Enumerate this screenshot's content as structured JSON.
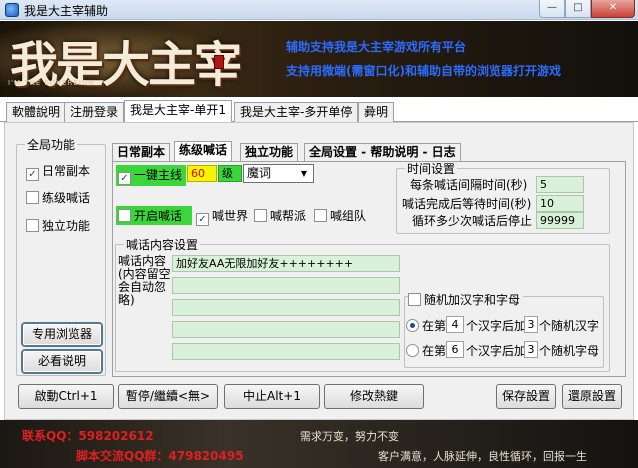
{
  "window": {
    "title": "我是大主宰辅助"
  },
  "banner": {
    "logo_text": "我是大主宰",
    "logo_sub": "I'M THE SOVEREIGN",
    "line1": "辅助支持我是大主宰游戏所有平台",
    "line2": "支持用微端(需窗口化)和辅助自带的浏览器打开游戏"
  },
  "main_tabs": [
    "軟體說明",
    "注册登录",
    "我是大主宰-单开1",
    "我是大主宰-多开单停",
    "彜明"
  ],
  "global": {
    "legend": "全局功能",
    "items": [
      {
        "label": "日常副本",
        "checked": true
      },
      {
        "label": "练级喊话",
        "checked": false
      },
      {
        "label": "独立功能",
        "checked": false
      }
    ],
    "browser_btn": "专用浏览器",
    "help_btn": "必看说明"
  },
  "sub_tabs": [
    "日常副本",
    "练级喊话",
    "独立功能",
    "全局设置 - 帮助说明 - 日志"
  ],
  "level": {
    "label": "一键主线",
    "value": "60",
    "unit": "级",
    "select": "魔词"
  },
  "channels": [
    {
      "label": "开启喊话",
      "checked": false,
      "green": true
    },
    {
      "label": "喊世界",
      "checked": true
    },
    {
      "label": "喊帮派",
      "checked": false
    },
    {
      "label": "喊组队",
      "checked": false
    }
  ],
  "timing": {
    "legend": "时间设置",
    "rows": [
      {
        "label": "每条喊话间隔时间(秒)",
        "value": "5"
      },
      {
        "label": "喊话完成后等待时间(秒)",
        "value": "10"
      },
      {
        "label": "循环多少次喊话后停止",
        "value": "99999"
      }
    ]
  },
  "content": {
    "legend": "喊话内容设置",
    "label": "喊话内容(内容留空会自动忽略)",
    "lines": [
      "加好友AA无限加好友++++++++",
      "",
      "",
      "",
      ""
    ]
  },
  "random": {
    "legend": "随机加汉字和字母",
    "checked": false,
    "rows": [
      {
        "prefix": "在第",
        "pos": "4",
        "mid": "个汉字后加",
        "count": "3",
        "suffix": "个随机汉字",
        "selected": true
      },
      {
        "prefix": "在第",
        "pos": "6",
        "mid": "个汉字后加",
        "count": "3",
        "suffix": "个随机字母",
        "selected": false
      }
    ]
  },
  "bottom_buttons": {
    "start": "啟動Ctrl+1",
    "pause": "暫停/繼續<無>",
    "stop": "中止Alt+1",
    "hotkey": "修改熱鍵",
    "save": "保存設置",
    "restore": "還原設置"
  },
  "footer": {
    "qq": "联系QQ：598202612",
    "group": "脚本交流QQ群：479820495",
    "slogan1": "需求万变，努力不变",
    "slogan2": "客户满意，人脉延伸，良性循环，回报一生"
  }
}
